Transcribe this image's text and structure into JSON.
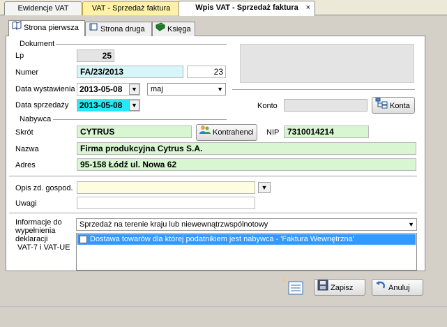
{
  "tabs": [
    {
      "label": "Ewidencje VAT"
    },
    {
      "label": "VAT - Sprzedaż faktura"
    },
    {
      "label": "Wpis VAT - Sprzedaż faktura",
      "close": "×"
    }
  ],
  "inner_tabs": [
    {
      "label": "Strona pierwsza"
    },
    {
      "label": "Strona druga"
    },
    {
      "label": "Księga"
    }
  ],
  "dokument": {
    "group_label": "Dokument",
    "lp_label": "Lp",
    "lp_value": "25",
    "numer_label": "Numer",
    "numer_value": "FA/23/2013",
    "numer_seq": "23",
    "data_wyst_label": "Data wystawienia",
    "data_wyst_value": "2013-05-08",
    "month_value": "maj",
    "data_sprz_label": "Data sprzedaży",
    "data_sprz_value": "2013-05-08"
  },
  "konto": {
    "label": "Konto",
    "value": "",
    "button": "Konta",
    "button_underline": "K"
  },
  "nabywca": {
    "group_label": "Nabywca",
    "skrot_label": "Skrót",
    "skrot_value": "CYTRUS",
    "kontrahenci_button": "Kontrahenci",
    "kontrahenci_underline": "K",
    "nip_label": "NIP",
    "nip_value": "7310014214",
    "nazwa_label": "Nazwa",
    "nazwa_value": "Firma produkcyjna Cytrus S.A.",
    "adres_label": "Adres",
    "adres_value": "95-158 Łódź ul. Nowa 62"
  },
  "opis": {
    "label": "Opis zd. gospod.",
    "value": ""
  },
  "uwagi": {
    "label": "Uwagi",
    "value": ""
  },
  "informacje": {
    "label_lines": [
      "Informacje do",
      "wypełnienia",
      "deklaracji",
      "VAT-7 i VAT-UE"
    ],
    "select_value": "Sprzedaż na terenie kraju lub niewewnątrzwspólnotowy",
    "list_items": [
      {
        "label": "Dostawa towarów dla której podatnikiem jest nabywca - 'Faktura Wewnętrzna'",
        "checked": false,
        "selected": true
      }
    ]
  },
  "footer": {
    "zapisz": "Zapisz",
    "anuluj": "Anuluj"
  },
  "colors": {
    "green_field": "#d9f6d2",
    "cyan_field": "#d6f6fa",
    "selection": "#3399ff"
  },
  "icons": [
    "book-open-icon",
    "book-icon",
    "green-book-icon",
    "accounts-tree-icon",
    "contacts-icon",
    "new-doc-icon",
    "save-disk-icon",
    "undo-arrow-icon"
  ]
}
